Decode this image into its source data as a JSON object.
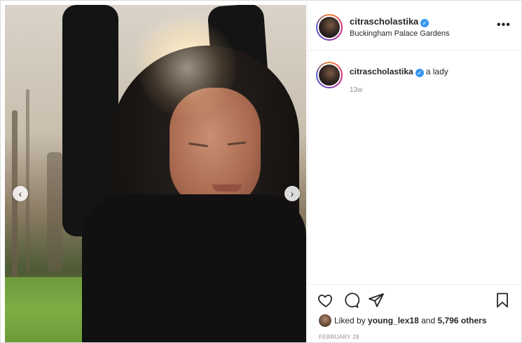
{
  "post": {
    "username": "citrascholastika",
    "location": "Buckingham Palace Gardens",
    "more_label": "•••",
    "caption_user": "citrascholastika",
    "caption_text": "a lady",
    "caption_age": "13w",
    "liked_by_prefix": "Liked by",
    "liked_by_user": "young_lex18",
    "liked_by_and": "and",
    "others_count": "5,796 others",
    "date": "FEBRUARY 28"
  },
  "media": {
    "prev_label": "‹",
    "next_label": "›"
  },
  "colors": {
    "verified": "#3897f0",
    "text_primary": "#262626",
    "text_secondary": "#8e8e8e",
    "border": "#efefef"
  },
  "icons": {
    "verified": "verified-badge-icon",
    "more": "more-options-icon",
    "like": "heart-icon",
    "comment": "comment-icon",
    "share": "paper-plane-icon",
    "save": "bookmark-icon",
    "prev": "chevron-left-icon",
    "next": "chevron-right-icon"
  }
}
